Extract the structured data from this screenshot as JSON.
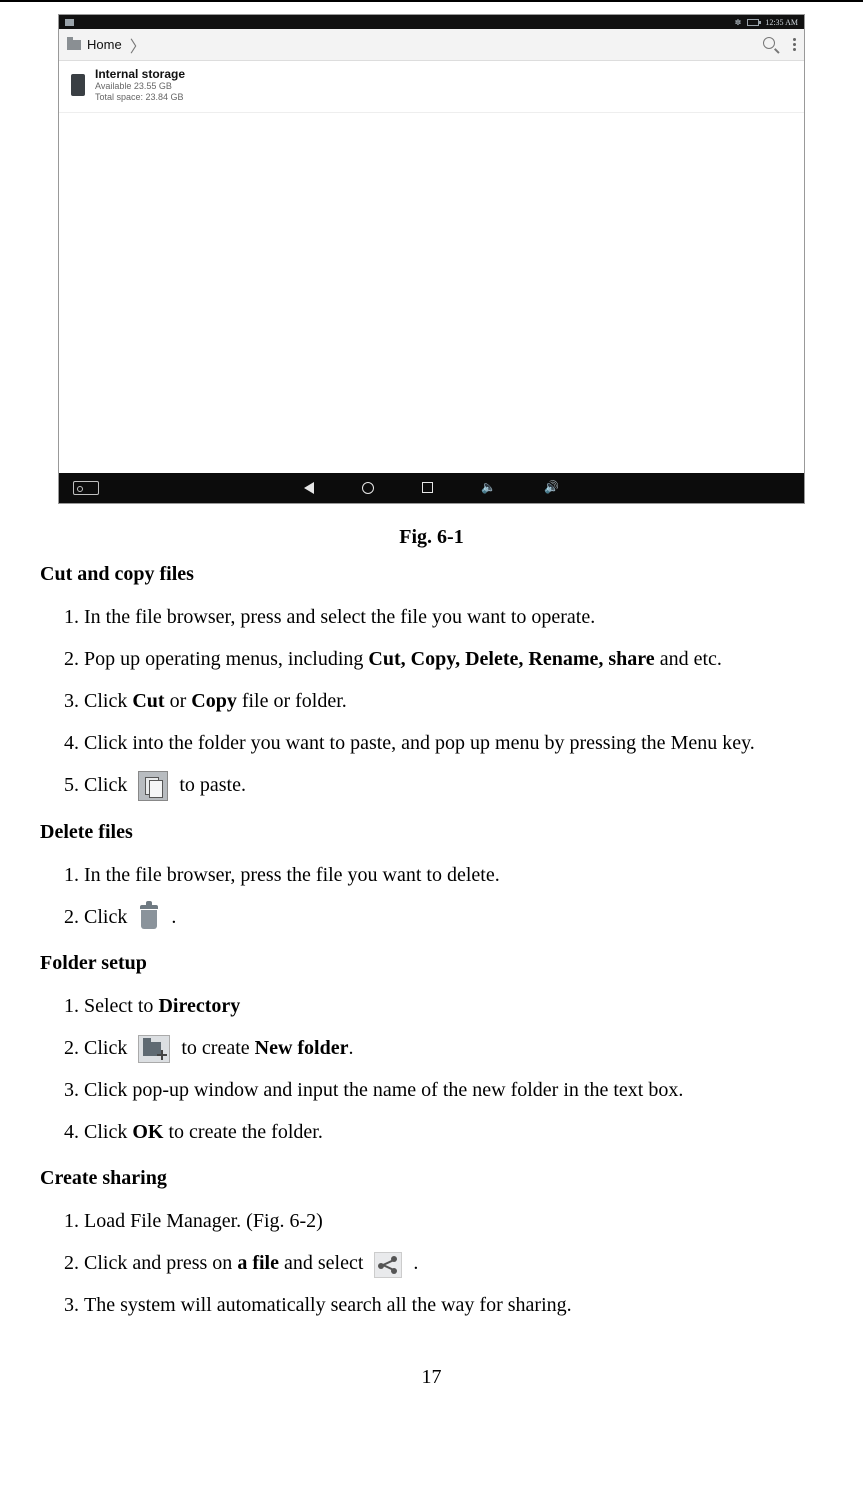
{
  "page_number": "17",
  "figure": {
    "caption": "Fig. 6-1",
    "statusbar": {
      "time": "12:35 AM"
    },
    "breadcrumb": {
      "home": "Home"
    },
    "storage": {
      "title": "Internal storage",
      "available": "Available 23.55 GB",
      "total": "Total space: 23.84 GB"
    }
  },
  "sections": {
    "cut_copy": {
      "heading": "Cut and copy files",
      "steps": {
        "s1": "In the file browser, press and select the file you want to operate.",
        "s2_a": "Pop up operating menus, including ",
        "s2_b_bold": "Cut, Copy, Delete, Rename, share",
        "s2_c": " and etc.",
        "s3_a": "Click ",
        "s3_b_bold": "Cut",
        "s3_c": " or ",
        "s3_d_bold": "Copy",
        "s3_e": " file or folder.",
        "s4": "Click into the folder you want to paste, and pop up menu by pressing the Menu key.",
        "s5_a": "Click ",
        "s5_b": " to paste."
      }
    },
    "delete": {
      "heading": "Delete files",
      "steps": {
        "s1": "In the file browser, press the file you want to delete.",
        "s2_a": "Click ",
        "s2_b": "."
      }
    },
    "folder": {
      "heading": "Folder setup",
      "steps": {
        "s1_a": "Select to ",
        "s1_b_bold": "Directory",
        "s2_a": "Click ",
        "s2_b": " to create ",
        "s2_c_bold": "New folder",
        "s2_d": ".",
        "s3": "Click pop-up window and input the name of the new folder in the text box.",
        "s4_a": "Click ",
        "s4_b_bold": "OK",
        "s4_c": " to create the folder."
      }
    },
    "share": {
      "heading": "Create sharing",
      "steps": {
        "s1": "Load File Manager. (Fig. 6-2)",
        "s2_a": "Click and press on ",
        "s2_b_bold": "a file",
        "s2_c": " and select ",
        "s2_d": " .",
        "s3": "The system will automatically search all the way for sharing."
      }
    }
  }
}
